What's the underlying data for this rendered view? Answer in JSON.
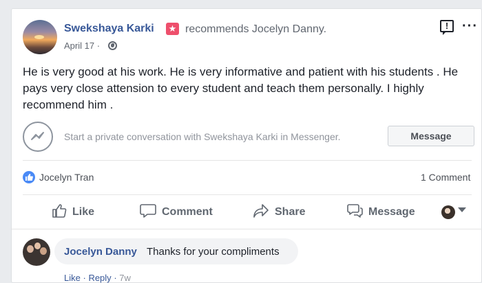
{
  "post": {
    "author": "Swekshaya Karki",
    "badge_icon": "star-badge-icon",
    "recommends_text": "recommends Jocelyn Danny.",
    "date": "April 17",
    "date_separator": "·",
    "privacy_icon": "globe-icon",
    "body": "He is very good at his work. He is very informative and patient with his students . He pays very close attension to every student and teach them personally. I highly recommend him ."
  },
  "messenger": {
    "prompt": "Start a private conversation with Swekshaya Karki in Messenger.",
    "button_label": "Message"
  },
  "reactions": {
    "liker": "Jocelyn Tran",
    "comment_count": "1 Comment"
  },
  "actions": {
    "like": "Like",
    "comment": "Comment",
    "share": "Share",
    "message": "Message"
  },
  "comment": {
    "author": "Jocelyn Danny",
    "text": "Thanks for your compliments",
    "like_label": "Like",
    "reply_label": "Reply",
    "time": "7w"
  },
  "colors": {
    "link_blue": "#385898",
    "like_blue": "#4a8af6",
    "badge_pink": "#ee4f6c"
  }
}
